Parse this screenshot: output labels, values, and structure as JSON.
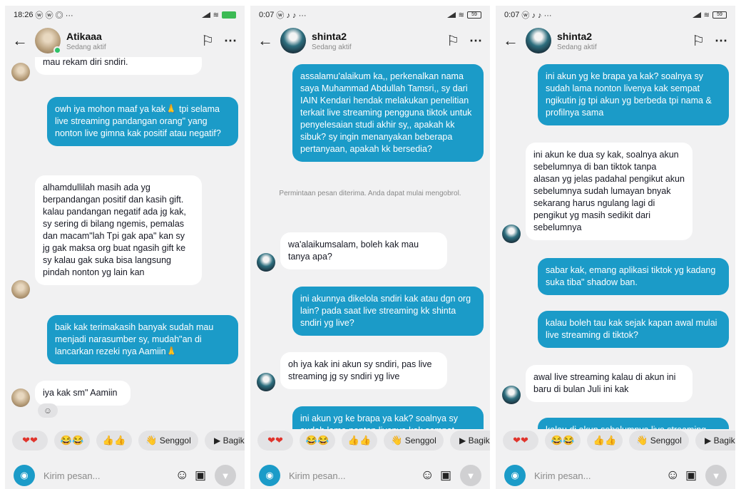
{
  "screens": [
    {
      "status": {
        "time": "18:26",
        "icons": "ⓦ ⓦ ◎ ···",
        "battery": ""
      },
      "header": {
        "name": "Atikaaa",
        "status": "Sedang aktif"
      },
      "messages": [
        {
          "from": "in",
          "text": "mau rekam diri sndiri."
        },
        {
          "from": "out",
          "text": "owh iya mohon maaf ya kak🙏 tpi selama live streaming pandangan orang\" yang nonton live gimna kak positif atau negatif?"
        },
        {
          "from": "in",
          "text": "alhamdullilah masih ada yg berpandangan positif dan kasih gift. kalau pandangan negatif ada jg kak, sy sering di bilang ngemis, pemalas dan macam\"lah Tpi gak apa\" kan sy jg gak maksa org buat ngasih gift ke sy kalau gak suka bisa langsung pindah nonton yg lain kan"
        },
        {
          "from": "out",
          "text": "baik kak terimakasih banyak sudah mau menjadi narasumber sy, mudah\"an di lancarkan rezeki nya Aamiin🙏"
        },
        {
          "from": "in",
          "text": "iya kak sm\" Aamiin"
        }
      ]
    },
    {
      "status": {
        "time": "0:07",
        "icons": "ⓦ ♪ ♪ ···",
        "battery": "59"
      },
      "header": {
        "name": "shinta2",
        "status": "Sedang aktif"
      },
      "messages": [
        {
          "from": "out",
          "text": "assalamu'alaikum ka,, perkenalkan nama saya Muhammad Abdullah Tamsri,, sy dari IAIN Kendari hendak melakukan penelitian terkait live streaming pengguna tiktok untuk penyelesaian studi akhir sy,, apakah kk sibuk? sy ingin menanyakan beberapa pertanyaan, apakah kk bersedia?"
        },
        {
          "from": "system",
          "text": "Permintaan pesan diterima. Anda dapat mulai mengobrol."
        },
        {
          "from": "in",
          "text": "wa'alaikumsalam, boleh kak mau tanya apa?"
        },
        {
          "from": "out",
          "text": "ini akunnya dikelola sndiri kak atau dgn org lain? pada saat live streaming kk shinta sndiri yg live?"
        },
        {
          "from": "in",
          "text": "oh iya kak ini akun sy sndiri, pas live streaming jg sy sndiri yg live"
        },
        {
          "from": "out",
          "text": "ini akun yg ke brapa ya kak? soalnya sy sudah lama nonton livenya kak sempat"
        }
      ]
    },
    {
      "status": {
        "time": "0:07",
        "icons": "ⓦ ♪ ♪ ···",
        "battery": "59"
      },
      "header": {
        "name": "shinta2",
        "status": "Sedang aktif"
      },
      "messages": [
        {
          "from": "out",
          "text": "ini akun yg ke brapa ya kak? soalnya sy sudah lama nonton livenya kak sempat ngikutin jg tpi akun yg berbeda tpi nama & profilnya sama"
        },
        {
          "from": "in",
          "text": "ini akun ke dua sy kak, soalnya akun sebelumnya di ban tiktok tanpa alasan yg jelas padahal pengikut akun sebelumnya sudah lumayan bnyak sekarang harus ngulang lagi di pengikut yg masih sedikit dari sebelumnya"
        },
        {
          "from": "out",
          "text": "sabar kak, emang aplikasi tiktok yg kadang suka tiba\" shadow ban."
        },
        {
          "from": "out",
          "text": "kalau boleh tau kak sejak kapan awal mulai live streaming di tiktok?"
        },
        {
          "from": "in",
          "text": "awal live streaming kalau di akun ini baru di bulan Juli ini kak"
        },
        {
          "from": "out",
          "text": "kalau di akun sebelumnya live streaming"
        }
      ]
    }
  ],
  "quick_replies": {
    "hearts": "❤❤",
    "laugh": "😂😂",
    "thumbs": "👍👍",
    "senggol_icon": "👋",
    "senggol": "Senggol",
    "share": "Bagikan"
  },
  "composer": {
    "placeholder": "Kirim pesan..."
  },
  "icons": {
    "back": "back-arrow-icon",
    "flag": "flag-icon",
    "more": "more-icon",
    "camera": "camera-icon",
    "emoji": "emoji-icon",
    "image": "image-icon",
    "send": "send-icon"
  },
  "colors": {
    "outgoing_bubble": "#1b9bc8",
    "incoming_bubble": "#ffffff",
    "background": "#f1f1f2",
    "online": "#2ec26a"
  }
}
